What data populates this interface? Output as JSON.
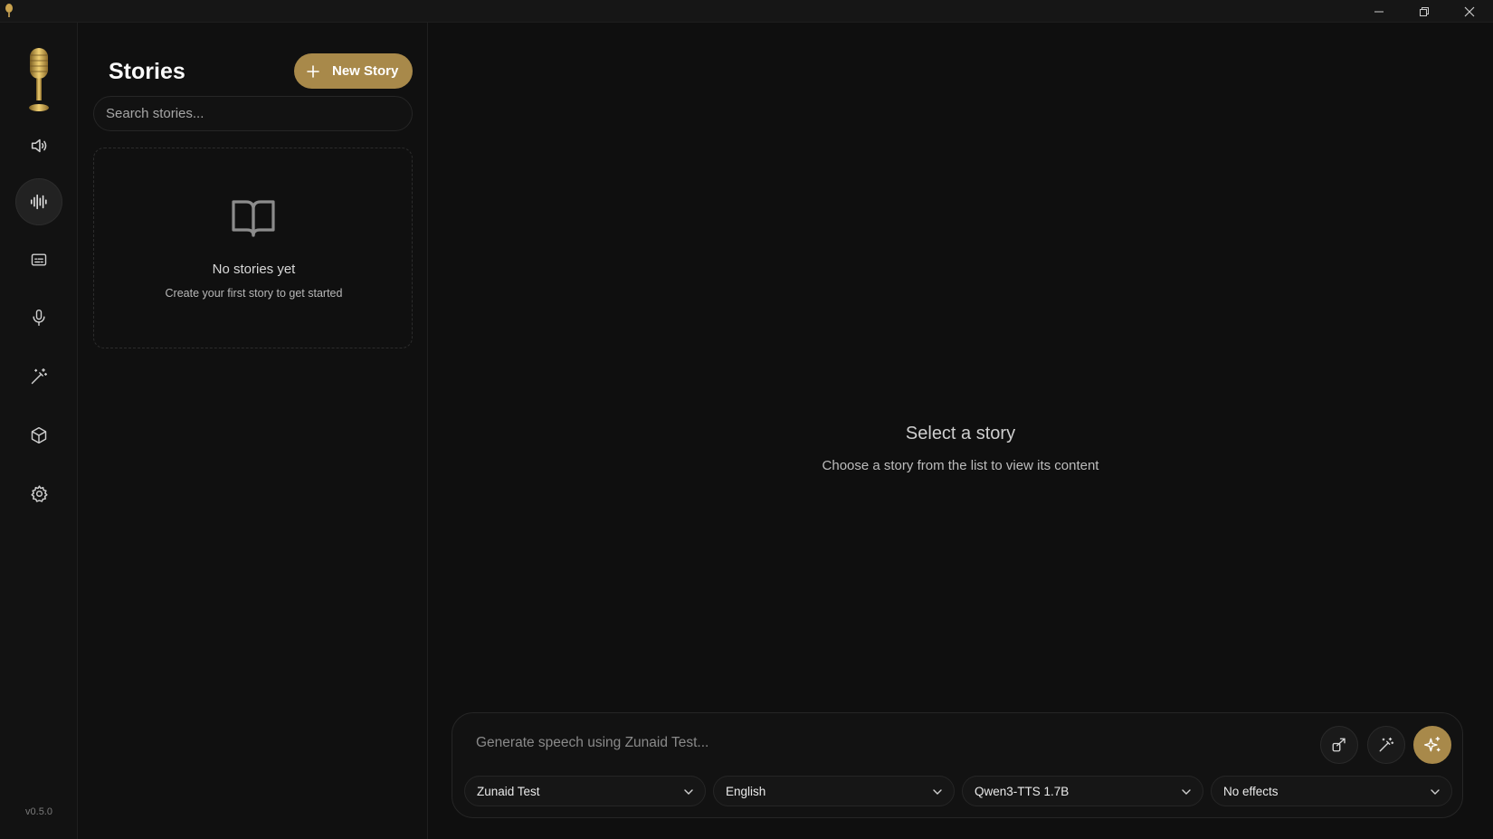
{
  "window": {
    "minimize_icon": "minimize-icon",
    "maximize_icon": "restore-icon",
    "close_icon": "close-icon"
  },
  "sidebar": {
    "logo_icon": "microphone-logo-icon",
    "items": [
      {
        "id": "speech",
        "icon": "speaker-icon"
      },
      {
        "id": "stories",
        "icon": "waveform-icon",
        "active": true
      },
      {
        "id": "captions",
        "icon": "caption-icon"
      },
      {
        "id": "voices",
        "icon": "microphone-icon"
      },
      {
        "id": "effects",
        "icon": "magic-wand-icon"
      },
      {
        "id": "models",
        "icon": "box-icon"
      },
      {
        "id": "settings",
        "icon": "gear-icon"
      }
    ],
    "version": "v0.5.0"
  },
  "stories_panel": {
    "title": "Stories",
    "new_story_label": "New Story",
    "search_placeholder": "Search stories...",
    "empty_icon": "open-book-icon",
    "empty_title": "No stories yet",
    "empty_subtitle": "Create your first story to get started"
  },
  "main": {
    "empty_title": "Select a story",
    "empty_subtitle": "Choose a story from the list to view its content"
  },
  "composer": {
    "placeholder": "Generate speech using Zunaid Test...",
    "voice": "Zunaid Test",
    "language": "English",
    "model": "Qwen3-TTS 1.7B",
    "effects": "No effects"
  },
  "colors": {
    "accent": "#a8894a",
    "background": "#0f0f0f",
    "surface": "#121212"
  }
}
